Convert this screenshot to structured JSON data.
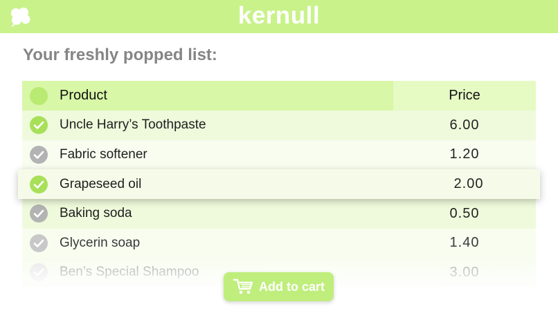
{
  "header": {
    "brand": "kernull",
    "logo_icon": "popcorn-icon"
  },
  "subtitle": "Your freshly popped list:",
  "table": {
    "columns": [
      "Product",
      "Price"
    ],
    "rows": [
      {
        "product": "Uncle Harry’s Toothpaste",
        "price": "6.00",
        "checked": true,
        "check_color": "green"
      },
      {
        "product": "Fabric softener",
        "price": "1.20",
        "checked": true,
        "check_color": "gray"
      },
      {
        "product": "Grapeseed oil",
        "price": "2.00",
        "checked": true,
        "check_color": "green",
        "highlighted": true
      },
      {
        "product": "Baking soda",
        "price": "0.50",
        "checked": true,
        "check_color": "gray"
      },
      {
        "product": "Glycerin soap",
        "price": "1.40",
        "checked": true,
        "check_color": "lightgray"
      },
      {
        "product": "Ben’s Special Shampoo",
        "price": "3.00",
        "checked": true,
        "check_color": "lightgray"
      }
    ]
  },
  "cart_button": {
    "label": "Add to cart",
    "icon": "shopping-cart-icon"
  },
  "colors": {
    "accent": "#c9f28a",
    "check_green": "#a8e05a",
    "check_gray": "#b3b3b3"
  }
}
